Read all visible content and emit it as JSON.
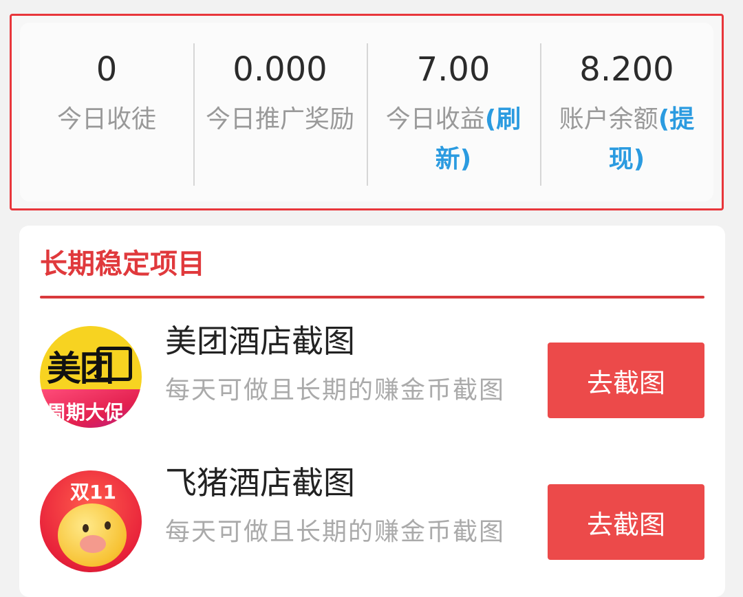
{
  "stats": [
    {
      "value": "0",
      "label": "今日收徒",
      "link": ""
    },
    {
      "value": "0.000",
      "label": "今日推广奖励",
      "link": ""
    },
    {
      "value": "7.00",
      "label": "今日收益",
      "link": "(刷新)"
    },
    {
      "value": "8.200",
      "label": "账户余额",
      "link": "(提现)"
    }
  ],
  "section": {
    "title": "长期稳定项目"
  },
  "items": [
    {
      "title": "美团酒店截图",
      "desc": "每天可做且长期的赚金币截图",
      "button": "去截图",
      "icon": "meituan-logo-icon",
      "icon_text": "美团",
      "icon_promo": "周期大促"
    },
    {
      "title": "飞猪酒店截图",
      "desc": "每天可做且长期的赚金币截图",
      "button": "去截图",
      "icon": "feizhu-pig-logo-icon",
      "icon_tag": "双11"
    }
  ],
  "colors": {
    "accent": "#e0393c",
    "button": "#ec4a4a",
    "link": "#2b9be0",
    "highlight_border": "#e8363b"
  }
}
